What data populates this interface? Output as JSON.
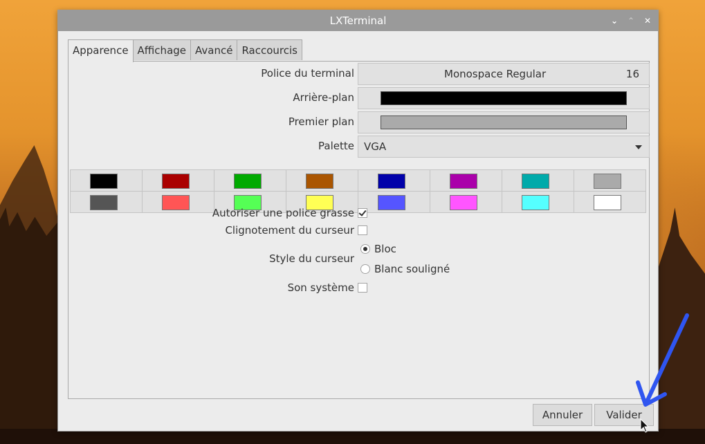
{
  "window": {
    "title": "LXTerminal"
  },
  "tabs": [
    "Apparence",
    "Affichage",
    "Avancé",
    "Raccourcis"
  ],
  "appearance": {
    "font_label": "Police du terminal",
    "font_name": "Monospace Regular",
    "font_size": "16",
    "background_label": "Arrière-plan",
    "background_color": "#000000",
    "foreground_label": "Premier plan",
    "foreground_color": "#aaaaaa",
    "palette_label": "Palette",
    "palette_value": "VGA"
  },
  "palette_colors": [
    [
      "#000000",
      "#aa0000",
      "#00aa00",
      "#aa5500",
      "#0000aa",
      "#aa00aa",
      "#00aaaa",
      "#aaaaaa"
    ],
    [
      "#555555",
      "#ff5555",
      "#55ff55",
      "#ffff55",
      "#5555ff",
      "#ff55ff",
      "#55ffff",
      "#ffffff"
    ]
  ],
  "options": {
    "bold_label": "Autoriser une police grasse",
    "bold_checked": true,
    "blink_label": "Clignotement du curseur",
    "blink_checked": false,
    "cursor_style_label": "Style du curseur",
    "cursor_styles": [
      "Bloc",
      "Blanc souligné"
    ],
    "cursor_style_selected": "Bloc",
    "sound_label": "Son système",
    "sound_checked": false
  },
  "buttons": {
    "cancel": "Annuler",
    "ok": "Valider"
  },
  "annotation": {
    "arrow_color": "#2f55f0"
  }
}
